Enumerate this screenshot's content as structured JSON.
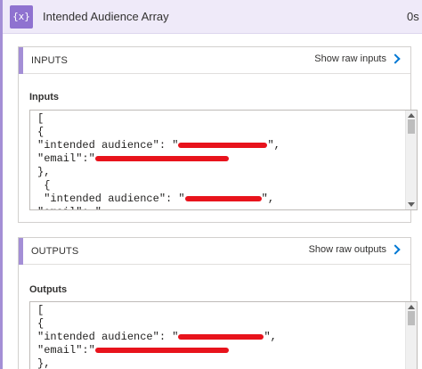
{
  "header": {
    "icon_glyph": "{x}",
    "title": "Intended Audience Array",
    "duration": "0s"
  },
  "inputs": {
    "section_title": "INPUTS",
    "raw_link": "Show raw inputs",
    "subheading": "Inputs",
    "lines": [
      {
        "pre": "[",
        "redact": 0,
        "post": ""
      },
      {
        "pre": "{",
        "redact": 0,
        "post": ""
      },
      {
        "pre": "\"intended audience\": \"",
        "redact": 1,
        "post": "\","
      },
      {
        "pre": "\"email\":\"",
        "redact": 1,
        "post": ""
      },
      {
        "pre": "},",
        "redact": 0,
        "post": ""
      },
      {
        "pre": " {",
        "redact": 0,
        "post": ""
      },
      {
        "pre": " \"intended audience\": \"",
        "redact": 1,
        "post": "\","
      },
      {
        "pre": "\"email\": \"",
        "redact": 1,
        "post": ""
      }
    ]
  },
  "outputs": {
    "section_title": "OUTPUTS",
    "raw_link": "Show raw outputs",
    "subheading": "Outputs",
    "lines": [
      {
        "pre": "[",
        "redact": 0,
        "post": ""
      },
      {
        "pre": "{",
        "redact": 0,
        "post": ""
      },
      {
        "pre": "\"intended audience\": \"",
        "redact": 1,
        "post": "\","
      },
      {
        "pre": "\"email\":\"",
        "redact": 1,
        "post": ""
      },
      {
        "pre": "},",
        "redact": 0,
        "post": ""
      }
    ]
  },
  "colors": {
    "accent": "#a48fd6",
    "icon_bg": "#8f72d0",
    "link_chevron": "#0078d4",
    "redaction": "#e8131c"
  },
  "icons": {
    "action": "variable-braces-icon",
    "link": "chevron-right-icon"
  }
}
